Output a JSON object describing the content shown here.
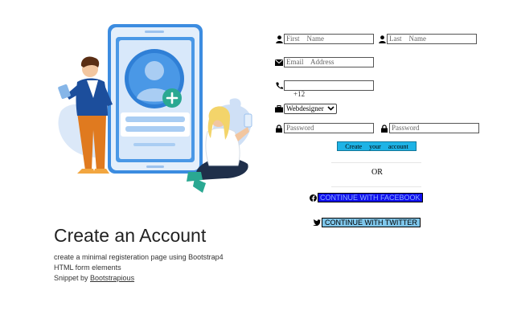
{
  "illustration": {
    "name": "signup-illustration"
  },
  "heading": {
    "title": "Create an Account",
    "line1": "create a minimal registeration page using Bootstrap4",
    "line2": "HTML form elements",
    "snippet_prefix": "Snippet by ",
    "snippet_link": "Bootstrapious"
  },
  "form": {
    "first_name_placeholder": "First    Name",
    "last_name_placeholder": "Last    Name",
    "email_placeholder": "Email    Address",
    "phone_prefix": "+12",
    "job_selected": "Webdesigner",
    "password_placeholder": "Password",
    "confirm_password_placeholder": "Password",
    "create_label": "Create your account",
    "or_label": "OR",
    "facebook_label": "CONTINUE WITH FACEBOOK",
    "twitter_label": "CONTINUE WITH TWITTER"
  },
  "icons": [
    "user-icon",
    "user-icon",
    "envelope-icon",
    "phone-icon",
    "briefcase-icon",
    "lock-icon",
    "lock-icon",
    "facebook-icon",
    "twitter-icon"
  ],
  "colors": {
    "create_button": "#1eb3e6",
    "facebook_button": "#1010ee",
    "twitter_button": "#7fc6ea",
    "illustration_blue": "#2f7fd6"
  }
}
